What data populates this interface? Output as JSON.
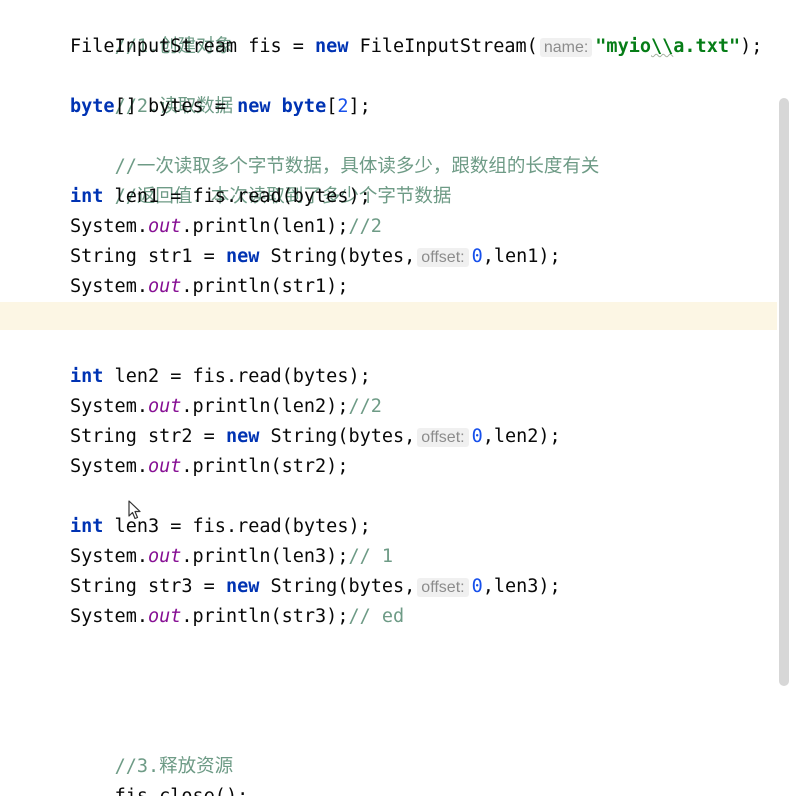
{
  "code": {
    "l1_comment": "//1.创建对象",
    "l2_type": "FileInputStream fis = ",
    "l2_new": "new",
    "l2_ctor": " FileInputStream(",
    "l2_hint": "name:",
    "l2_str_a": "\"myio",
    "l2_str_b": "\\\\",
    "l2_str_c": "a.txt\"",
    "l2_end": ");",
    "l3_comment": "//2.读取数据",
    "l4_kw1": "byte",
    "l4_mid": "[] bytes = ",
    "l4_new": "new",
    "l4_sp": " ",
    "l4_kw2": "byte",
    "l4_open": "[",
    "l4_num": "2",
    "l4_close": "];",
    "l5_comment": "//一次读取多个字节数据，具体读多少，跟数组的长度有关",
    "l6_comment": "//返回值：本次读取到了多少个字节数据",
    "b1_int": "int",
    "b1_read": " len1 = fis.read(bytes);",
    "b1_sys": "System.",
    "b1_out": "out",
    "b1_println": ".println(len1);",
    "b1_cm": "//2",
    "b1_str": "String str1 = ",
    "b1_new": "new",
    "b1_ctor": " String(bytes,",
    "b1_hint": "offset:",
    "b1_zero": "0",
    "b1_tail": ",len1);",
    "b1_sys2": "System.",
    "b1_out2": "out",
    "b1_println2": ".println(str1);",
    "b2_int": "int",
    "b2_read": " len2 = fis.read(bytes);",
    "b2_sys": "System.",
    "b2_out": "out",
    "b2_println": ".println(len2);",
    "b2_cm": "//2",
    "b2_str": "String str2 = ",
    "b2_new": "new",
    "b2_ctor": " String(bytes,",
    "b2_hint": "offset:",
    "b2_zero": "0",
    "b2_tail": ",len2);",
    "b2_sys2": "System.",
    "b2_out2": "out",
    "b2_println2": ".println(str2);",
    "b3_int": "int",
    "b3_read": " len3 = fis.read(bytes);",
    "b3_sys": "System.",
    "b3_out": "out",
    "b3_println": ".println(len3);",
    "b3_cm": "// 1",
    "b3_str": "String str3 = ",
    "b3_new": "new",
    "b3_ctor": " String(bytes,",
    "b3_hint": "offset:",
    "b3_zero": "0",
    "b3_tail": ",len3);",
    "b3_sys2": "System.",
    "b3_out2": "out",
    "b3_println2": ".println(str3);",
    "b3_cm2": "// ed",
    "l_close_comment": "//3.释放资源",
    "l_close": "fis.close();"
  },
  "colors": {
    "keyword": "#0033b3",
    "comment": "#6e9b86",
    "field": "#871094",
    "number": "#1750eb",
    "string": "#067d17",
    "caret_line": "#fcf6e4"
  },
  "icons": {
    "cursor": "mouse-pointer-icon"
  }
}
